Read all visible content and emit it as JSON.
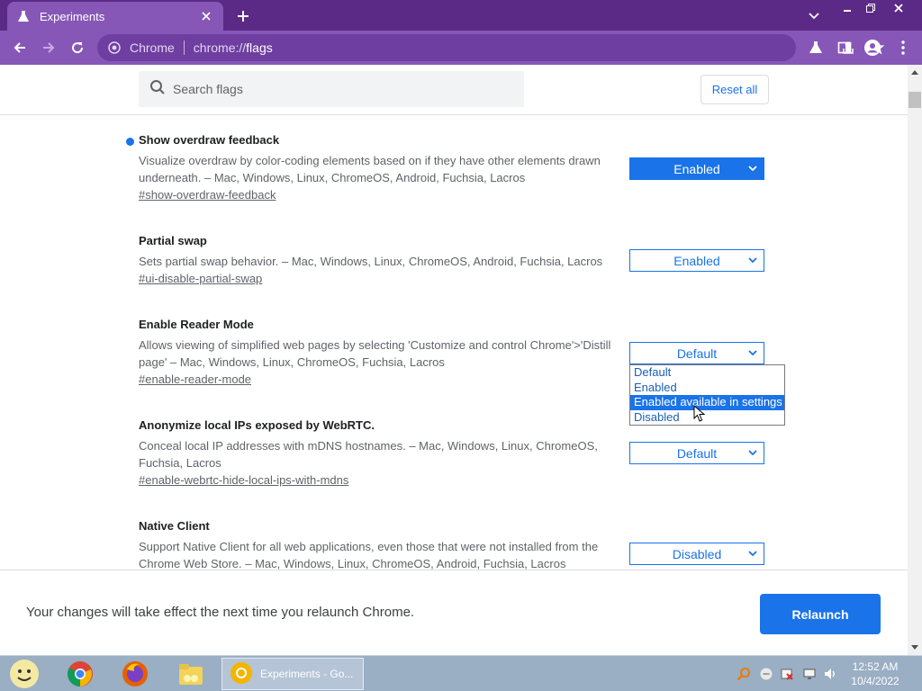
{
  "browser": {
    "tab_title": "Experiments",
    "omnibox_scheme": "Chrome",
    "omnibox_host": "chrome://",
    "omnibox_path": "flags",
    "accent_color": "#8757b8",
    "titlebar_color": "#5b2a86"
  },
  "header": {
    "search_placeholder": "Search flags",
    "reset_all_label": "Reset all"
  },
  "experiments": [
    {
      "name": "Show overdraw feedback",
      "description": "Visualize overdraw by color-coding elements based on if they have other elements drawn underneath. – Mac, Windows, Linux, ChromeOS, Android, Fuchsia, Lacros",
      "link": "#show-overdraw-feedback",
      "value": "Enabled",
      "modified": true
    },
    {
      "name": "Partial swap",
      "description": "Sets partial swap behavior. – Mac, Windows, Linux, ChromeOS, Android, Fuchsia, Lacros",
      "link": "#ui-disable-partial-swap",
      "value": "Enabled"
    },
    {
      "name": "Enable Reader Mode",
      "description": "Allows viewing of simplified web pages by selecting 'Customize and control Chrome'>'Distill page' – Mac, Windows, Linux, ChromeOS, Fuchsia, Lacros",
      "link": "#enable-reader-mode",
      "value": "Default",
      "dropdown_open": true,
      "options": [
        "Default",
        "Enabled",
        "Enabled available in settings",
        "Disabled"
      ],
      "highlighted_option": "Enabled available in settings"
    },
    {
      "name": "Anonymize local IPs exposed by WebRTC.",
      "description": "Conceal local IP addresses with mDNS hostnames. – Mac, Windows, Linux, ChromeOS, Fuchsia, Lacros",
      "link": "#enable-webrtc-hide-local-ips-with-mdns",
      "value": "Default"
    },
    {
      "name": "Native Client",
      "description": "Support Native Client for all web applications, even those that were not installed from the Chrome Web Store. – Mac, Windows, Linux, ChromeOS, Android, Fuchsia, Lacros",
      "value": "Disabled"
    }
  ],
  "relaunch": {
    "message": "Your changes will take effect the next time you relaunch Chrome.",
    "button_label": "Relaunch"
  },
  "taskbar": {
    "active_window_label": "Experiments - Go...",
    "clock_time": "12:52 AM",
    "clock_date": "10/4/2022"
  }
}
